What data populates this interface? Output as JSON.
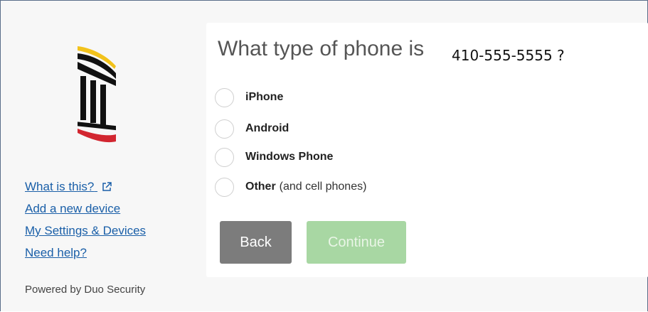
{
  "prompt": {
    "question": "What type of phone is",
    "phone_number": "410-555-5555 ?"
  },
  "options": [
    {
      "label": "iPhone",
      "sublabel": ""
    },
    {
      "label": "Android",
      "sublabel": ""
    },
    {
      "label": "Windows Phone",
      "sublabel": ""
    },
    {
      "label": "Other",
      "sublabel": "(and cell phones)"
    }
  ],
  "buttons": {
    "back": "Back",
    "continue": "Continue"
  },
  "sidebar": {
    "links": [
      {
        "label": "What is this?",
        "icon": "external-link-icon"
      },
      {
        "label": "Add a new device"
      },
      {
        "label": "My Settings & Devices"
      },
      {
        "label": "Need help?"
      }
    ],
    "powered_by": "Powered by Duo Security"
  },
  "colors": {
    "link": "#1a5fa8",
    "back_button": "#7c7c7c",
    "continue_button_disabled": "#a8d7a3",
    "logo_gold": "#f2c21b",
    "logo_red": "#d22630"
  }
}
